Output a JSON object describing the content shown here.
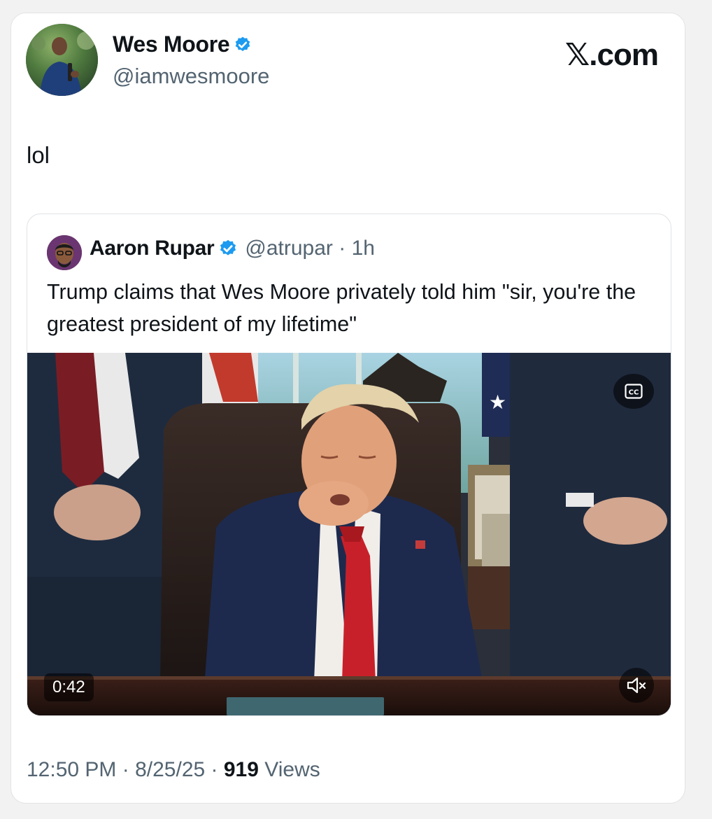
{
  "author": {
    "display_name": "Wes Moore",
    "handle": "@iamwesmoore",
    "verified_icon": "verified-badge-icon",
    "accent_color": "#1d9bf0"
  },
  "brand": "𝕏.com",
  "post": {
    "text": "lol"
  },
  "quoted_post": {
    "display_name": "Aaron Rupar",
    "handle": "@atrupar",
    "separator": " · ",
    "time_ago": "1h",
    "text": "Trump claims that Wes Moore privately told him \"sir, you're the greatest president of my lifetime\"",
    "video": {
      "duration": "0:42",
      "captions_icon": "closed-captions-icon",
      "mute_icon": "volume-muted-icon"
    }
  },
  "meta": {
    "time": "12:50 PM",
    "sep1": " · ",
    "date": "8/25/25",
    "sep2": " · ",
    "views_count": "919",
    "views_label": " Views"
  }
}
